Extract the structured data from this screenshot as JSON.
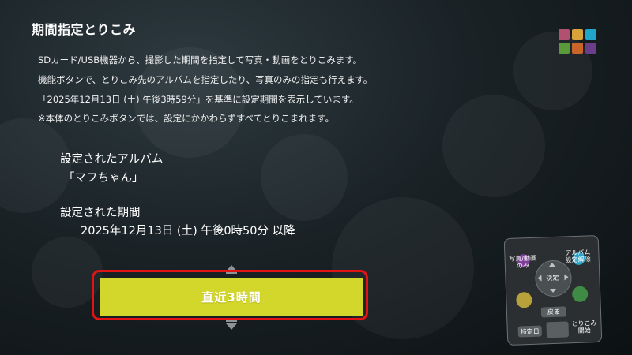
{
  "header": {
    "title": "期間指定とりこみ"
  },
  "description": {
    "lines": [
      "SDカード/USB機器から、撮影した期間を指定して写真・動画をとりこみます。",
      "機能ボタンで、とりこみ先のアルバムを指定したり、写真のみの指定も行えます。",
      "「2025年12月13日 (土) 午後3時59分」を基準に設定期間を表示しています。",
      "※本体のとりこみボタンでは、設定にかかわらずすべてとりこまれます。"
    ]
  },
  "album": {
    "label": "設定されたアルバム",
    "value": "「マフちゃん」"
  },
  "period": {
    "label": "設定された期間",
    "value": "2025年12月13日 (土) 午後0時50分 以降"
  },
  "selector": {
    "option": "直近3時間"
  },
  "menu_grid_colors": [
    "#b2506f",
    "#d8a33a",
    "#1fa6c9",
    "#5a9a3a",
    "#c9652a",
    "#6b3e8a"
  ],
  "remote_guide": {
    "photo_video": "写真/動画\nのみ",
    "album_reset": "アルバム\n設定解除",
    "ok": "決定",
    "back": "戻る",
    "specific_date": "特定日",
    "import_start": "とりこみ\n開始"
  }
}
